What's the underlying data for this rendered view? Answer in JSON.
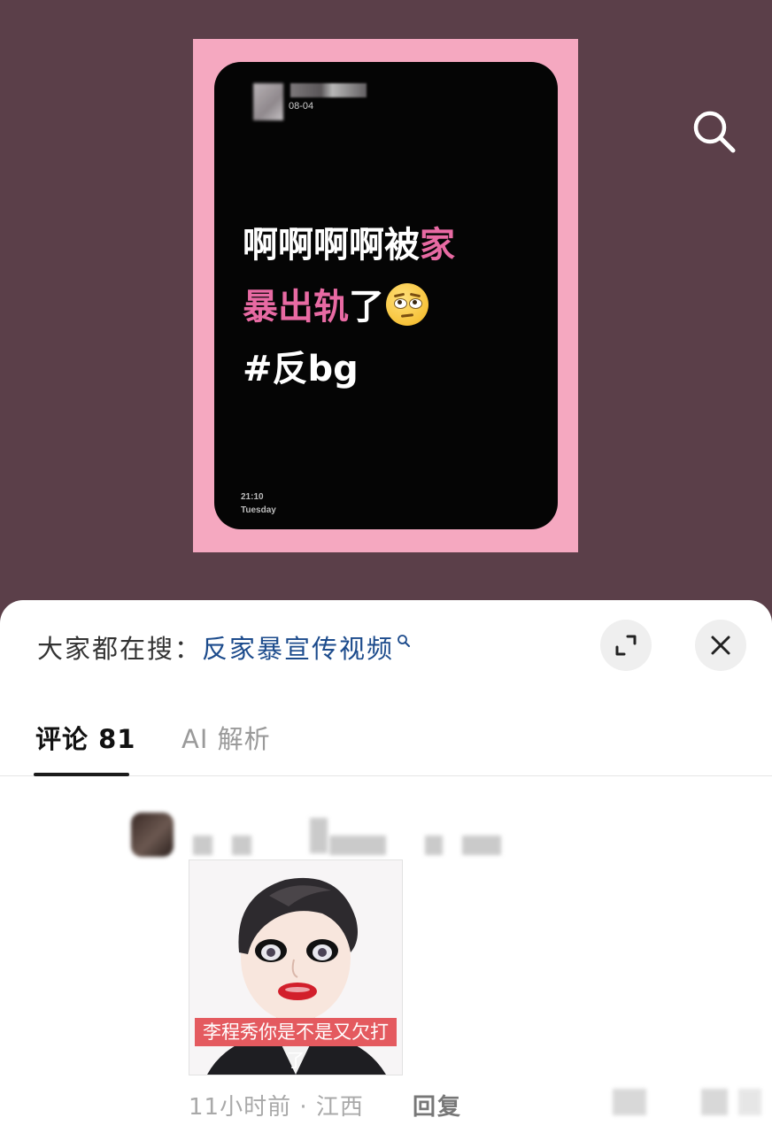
{
  "video": {
    "post_date": "08-04",
    "post_text_line1_white": "啊啊啊啊被",
    "post_text_line1_pink": "家",
    "post_text_line2_pink": "暴出轨",
    "post_text_line2_white": "了",
    "post_text_line3": "#反bg",
    "time": "21:10",
    "weekday": "Tuesday",
    "colors": {
      "background": "#5b3f49",
      "frame": "#f5a8c0",
      "pink_text": "#e86aa3"
    },
    "search_icon": "search-icon"
  },
  "sheet": {
    "search_prefix": "大家都在搜：",
    "search_keyword": "反家暴宣传视频",
    "expand_icon": "expand-icon",
    "close_icon": "close-icon",
    "tabs": [
      {
        "label": "评论 81",
        "active": true
      },
      {
        "label": "AI 解析",
        "active": false
      }
    ],
    "comment": {
      "sticker_caption": "李程秀你是不是又欠打了",
      "meta": "11小时前 · 江西",
      "reply_label": "回复"
    }
  }
}
